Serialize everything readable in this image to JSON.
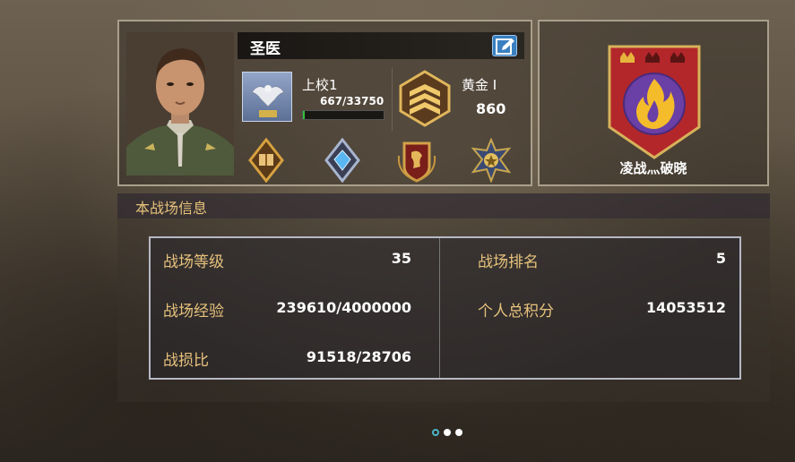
{
  "player": {
    "name": "圣医",
    "rank_name": "上校1",
    "exp_text": "667/33750",
    "exp_fraction": 0.02,
    "tier_name": "黄金 I",
    "tier_score": "860"
  },
  "clan": {
    "name": "凌战灬破晓"
  },
  "battlefield": {
    "title": "本战场信息",
    "stats": [
      {
        "label": "战场等级",
        "value": "35"
      },
      {
        "label": "战场排名",
        "value": "5"
      },
      {
        "label": "战场经验",
        "value": "239610/4000000"
      },
      {
        "label": "个人总积分",
        "value": "14053512"
      },
      {
        "label": "战损比",
        "value": "91518/28706"
      }
    ]
  },
  "pagination": {
    "total": 3,
    "current": 1
  },
  "icons": {
    "edit": "edit-icon",
    "rank": "colonel-eagle-icon",
    "tier": "gold-chevron-badge-icon",
    "medals": [
      "book-medal-icon",
      "diamond-medal-icon",
      "lion-medal-icon",
      "star-medal-icon"
    ],
    "clan": "flame-crest-icon"
  },
  "colors": {
    "gold_text": "#e7c27c",
    "exp_green": "#2fc13a",
    "clan_red": "#b3272a",
    "clan_purple": "#6a3fa6",
    "dot_active": "#4fb3c9"
  }
}
